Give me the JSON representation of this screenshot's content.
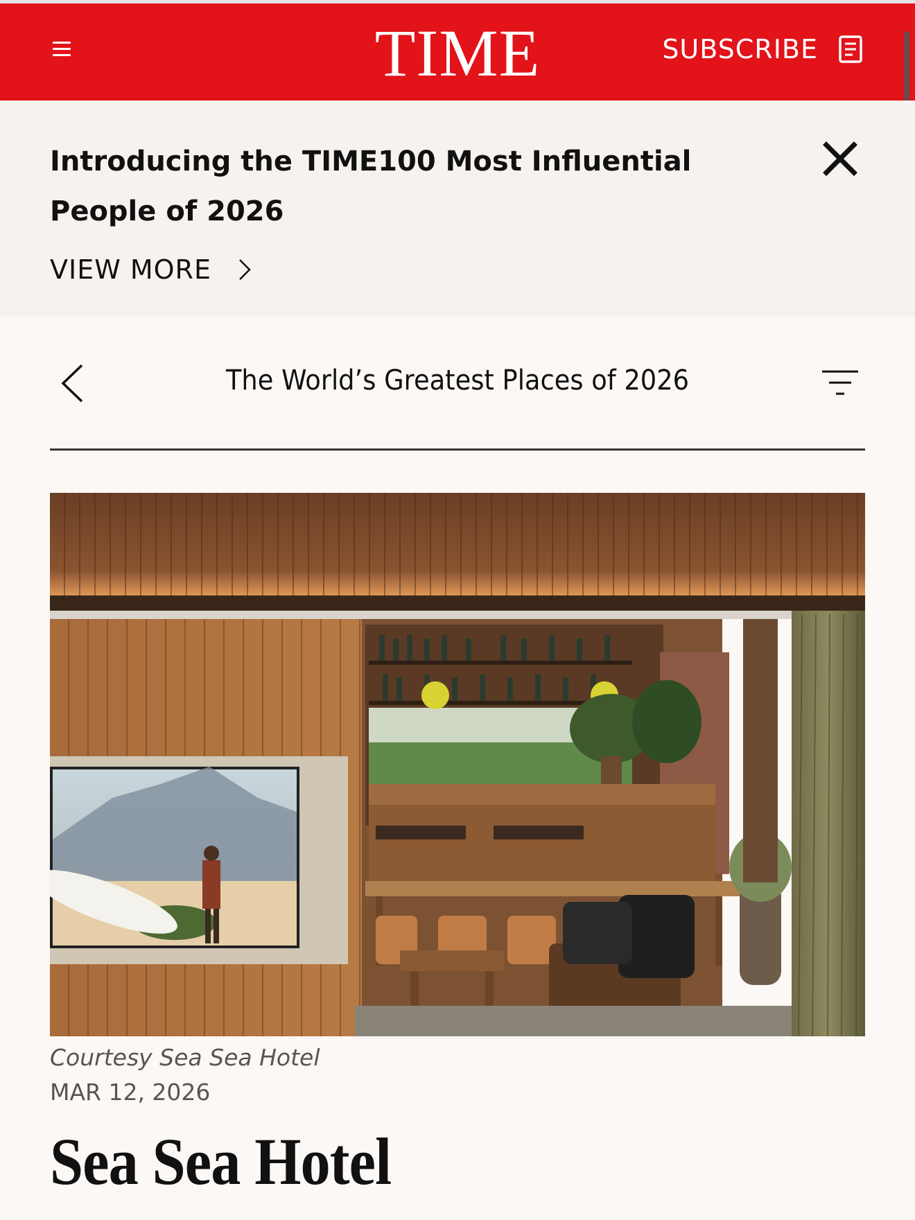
{
  "header": {
    "logo": "TIME",
    "subscribe_label": "SUBSCRIBE",
    "brand_color": "#e21319",
    "menu_icon": "hamburger-icon",
    "subscribe_icon": "document-icon"
  },
  "banner": {
    "title": "Introducing the TIME100 Most Influential People of 2026",
    "cta_label": "VIEW MORE",
    "close_icon": "close-icon"
  },
  "section_nav": {
    "title": "The World’s Greatest Places of 2026",
    "back_icon": "chevron-left-icon",
    "filter_icon": "filter-icon"
  },
  "article": {
    "image_caption": "Courtesy Sea Sea Hotel",
    "date": "MAR 12, 2026",
    "headline": "Sea Sea Hotel"
  }
}
